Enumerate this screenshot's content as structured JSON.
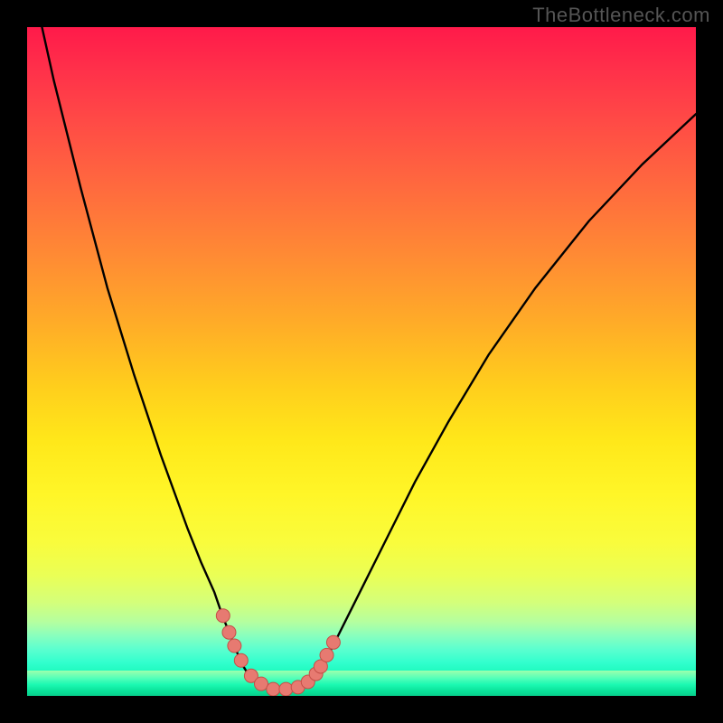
{
  "watermark": "TheBottleneck.com",
  "colors": {
    "frame": "#000000",
    "curve_stroke": "#000000",
    "marker_fill": "#e77a71",
    "marker_stroke": "#c44f47"
  },
  "chart_data": {
    "type": "line",
    "title": "",
    "xlabel": "",
    "ylabel": "",
    "xlim": [
      0,
      100
    ],
    "ylim": [
      0,
      100
    ],
    "grid": false,
    "legend": false,
    "note": "V-shaped bottleneck curve; y ≈ |mismatch %|. Gradient background encodes bottleneck severity (red high → green zero). Discrete markers are benchmarked sample points near the minimum.",
    "curve": {
      "name": "bottleneck-curve",
      "points_xy": [
        [
          0,
          110
        ],
        [
          4,
          92
        ],
        [
          8,
          76
        ],
        [
          12,
          61
        ],
        [
          16,
          48
        ],
        [
          20,
          36
        ],
        [
          24,
          25
        ],
        [
          26,
          20
        ],
        [
          28,
          15.5
        ],
        [
          29.2,
          12
        ],
        [
          30,
          10
        ],
        [
          30.8,
          8
        ],
        [
          31.6,
          6
        ],
        [
          32.4,
          4.3
        ],
        [
          33.2,
          3
        ],
        [
          34.2,
          2
        ],
        [
          35.5,
          1.3
        ],
        [
          37,
          1
        ],
        [
          38.5,
          1
        ],
        [
          40,
          1.2
        ],
        [
          41.2,
          1.6
        ],
        [
          42.2,
          2.2
        ],
        [
          43,
          3
        ],
        [
          43.8,
          4
        ],
        [
          45,
          6
        ],
        [
          46.5,
          9
        ],
        [
          48.5,
          13
        ],
        [
          51,
          18
        ],
        [
          54,
          24
        ],
        [
          58,
          32
        ],
        [
          63,
          41
        ],
        [
          69,
          51
        ],
        [
          76,
          61
        ],
        [
          84,
          71
        ],
        [
          92,
          79.5
        ],
        [
          100,
          87
        ]
      ]
    },
    "markers_xy": [
      [
        29.3,
        12.0
      ],
      [
        30.2,
        9.5
      ],
      [
        31.0,
        7.5
      ],
      [
        32.0,
        5.3
      ],
      [
        33.5,
        3.0
      ],
      [
        35.0,
        1.8
      ],
      [
        36.8,
        1.0
      ],
      [
        38.7,
        1.0
      ],
      [
        40.5,
        1.3
      ],
      [
        42.0,
        2.1
      ],
      [
        43.2,
        3.3
      ],
      [
        43.9,
        4.4
      ],
      [
        44.8,
        6.1
      ],
      [
        45.8,
        8.0
      ]
    ]
  }
}
